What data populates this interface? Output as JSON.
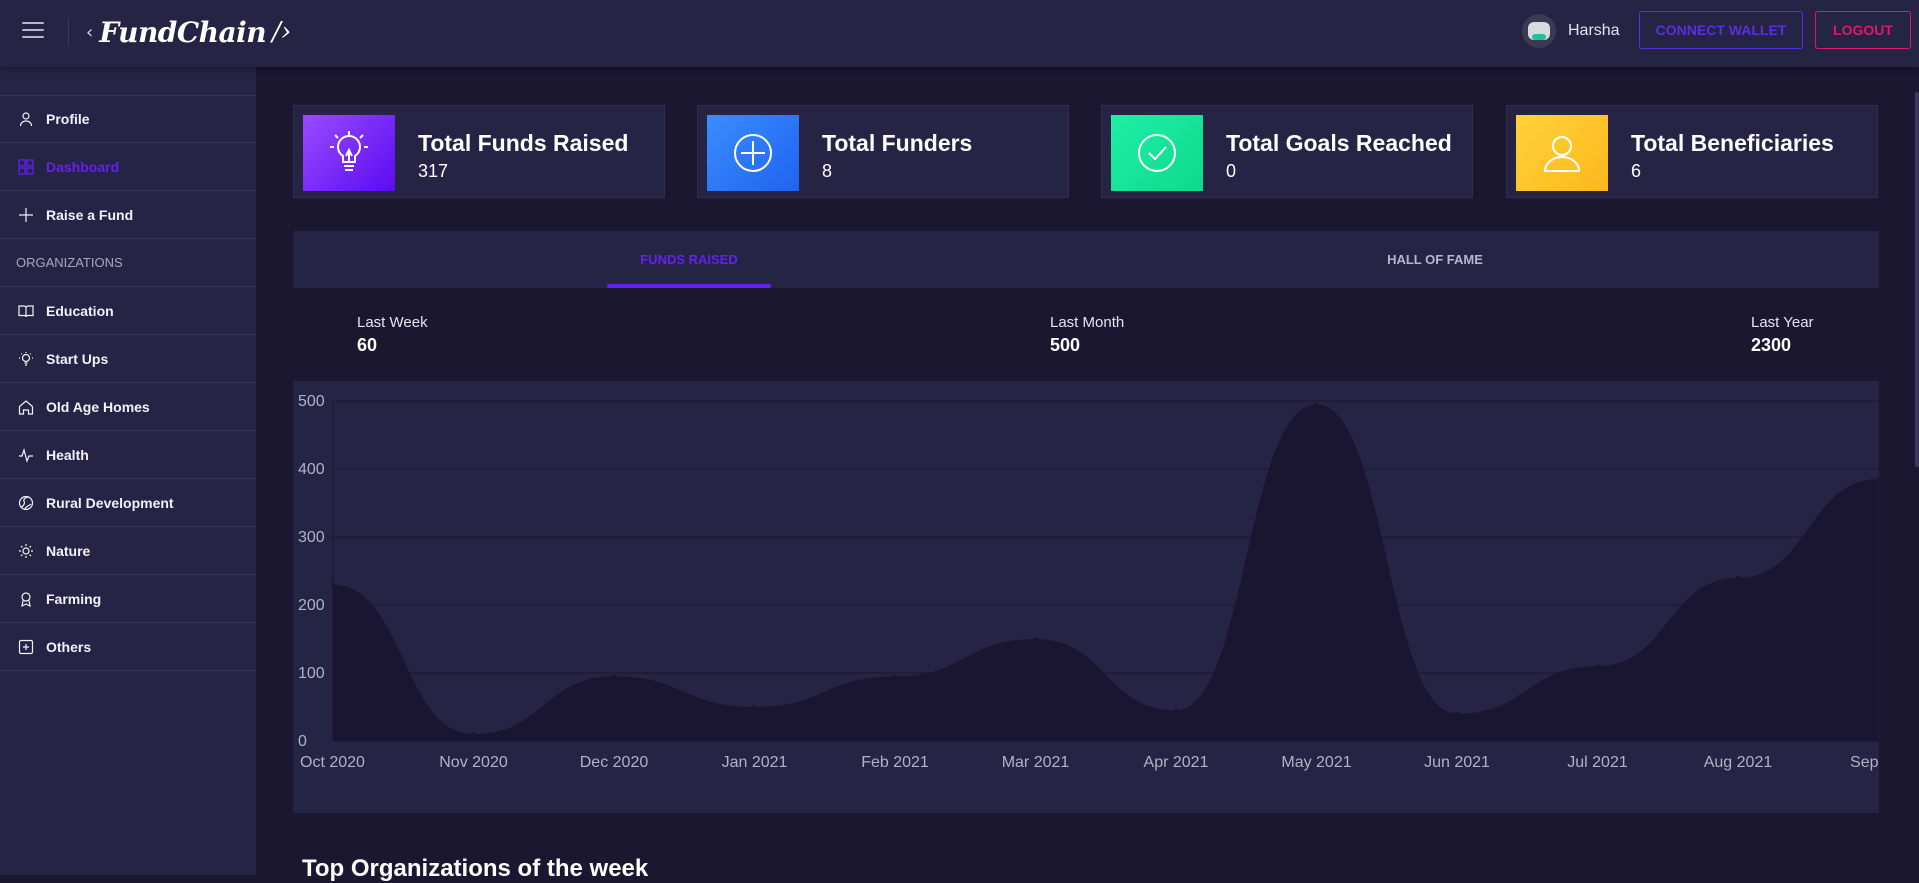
{
  "header": {
    "brand_prefix": "‹",
    "brand_name": "FundChain",
    "brand_suffix": "/›",
    "username": "Harsha",
    "connect_wallet_label": "CONNECT WALLET",
    "logout_label": "LOGOUT"
  },
  "sidebar": {
    "items": [
      {
        "label": "Profile",
        "icon": "user-icon"
      },
      {
        "label": "Dashboard",
        "icon": "grid-icon",
        "active": true
      },
      {
        "label": "Raise a Fund",
        "icon": "plus-icon"
      }
    ],
    "section_label": "ORGANIZATIONS",
    "organizations": [
      {
        "label": "Education",
        "icon": "book-icon"
      },
      {
        "label": "Start Ups",
        "icon": "bulb-icon"
      },
      {
        "label": "Old Age Homes",
        "icon": "home-icon"
      },
      {
        "label": "Health",
        "icon": "pulse-icon"
      },
      {
        "label": "Rural Development",
        "icon": "globe-icon"
      },
      {
        "label": "Nature",
        "icon": "sun-icon"
      },
      {
        "label": "Farming",
        "icon": "award-icon"
      },
      {
        "label": "Others",
        "icon": "plus-square-icon"
      }
    ]
  },
  "stats": [
    {
      "title": "Total Funds Raised",
      "value": "317",
      "icon": "lightbulb-icon",
      "color": "#6a11f5"
    },
    {
      "title": "Total Funders",
      "value": "8",
      "icon": "plus-circle-icon",
      "color": "#2b7ff5"
    },
    {
      "title": "Total Goals Reached",
      "value": "0",
      "icon": "check-circle-icon",
      "color": "#17e09a"
    },
    {
      "title": "Total Beneficiaries",
      "value": "6",
      "icon": "user-icon",
      "color": "#fec42c"
    }
  ],
  "tabs": {
    "funds_raised": "FUNDS RAISED",
    "hall_of_fame": "HALL OF FAME"
  },
  "periods": [
    {
      "label": "Last Week",
      "value": "60"
    },
    {
      "label": "Last Month",
      "value": "500"
    },
    {
      "label": "Last Year",
      "value": "2300"
    }
  ],
  "chart_data": {
    "type": "area",
    "categories": [
      "Oct 2020",
      "Nov 2020",
      "Dec 2020",
      "Jan 2021",
      "Feb 2021",
      "Mar 2021",
      "Apr 2021",
      "May 2021",
      "Jun 2021",
      "Jul 2021",
      "Aug 2021",
      "Sep"
    ],
    "values": [
      230,
      10,
      95,
      50,
      95,
      150,
      45,
      495,
      40,
      110,
      240,
      385
    ],
    "ylim": [
      0,
      500
    ],
    "yticks": [
      "0",
      "100",
      "200",
      "300",
      "400",
      "500"
    ],
    "grid": true,
    "colors": {
      "fill": "#1a1530",
      "background": "#262444",
      "grid": "#1a1530",
      "tick": "#b3b1c6"
    }
  },
  "section": {
    "top_orgs_title": "Top Organizations of the week"
  }
}
